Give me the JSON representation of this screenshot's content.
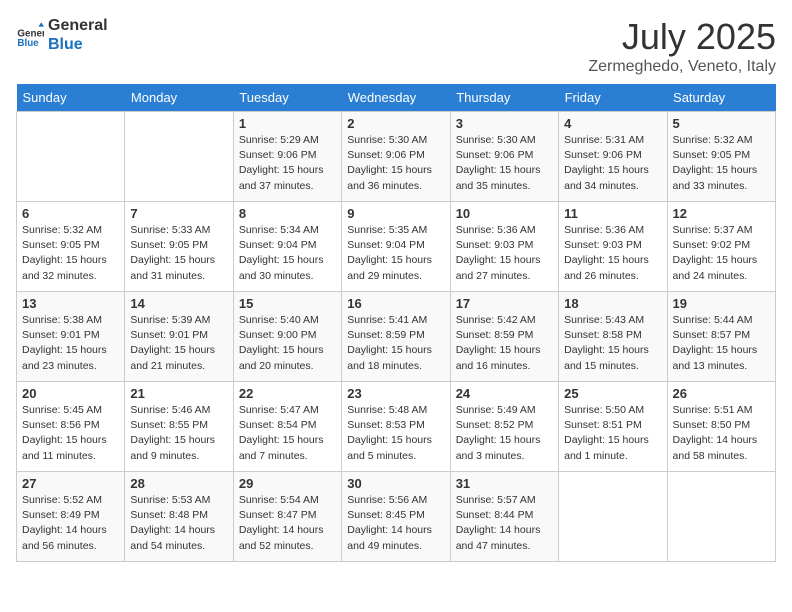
{
  "logo": {
    "line1": "General",
    "line2": "Blue"
  },
  "title": "July 2025",
  "location": "Zermeghedo, Veneto, Italy",
  "weekdays": [
    "Sunday",
    "Monday",
    "Tuesday",
    "Wednesday",
    "Thursday",
    "Friday",
    "Saturday"
  ],
  "weeks": [
    [
      {
        "day": "",
        "info": ""
      },
      {
        "day": "",
        "info": ""
      },
      {
        "day": "1",
        "info": "Sunrise: 5:29 AM\nSunset: 9:06 PM\nDaylight: 15 hours\nand 37 minutes."
      },
      {
        "day": "2",
        "info": "Sunrise: 5:30 AM\nSunset: 9:06 PM\nDaylight: 15 hours\nand 36 minutes."
      },
      {
        "day": "3",
        "info": "Sunrise: 5:30 AM\nSunset: 9:06 PM\nDaylight: 15 hours\nand 35 minutes."
      },
      {
        "day": "4",
        "info": "Sunrise: 5:31 AM\nSunset: 9:06 PM\nDaylight: 15 hours\nand 34 minutes."
      },
      {
        "day": "5",
        "info": "Sunrise: 5:32 AM\nSunset: 9:05 PM\nDaylight: 15 hours\nand 33 minutes."
      }
    ],
    [
      {
        "day": "6",
        "info": "Sunrise: 5:32 AM\nSunset: 9:05 PM\nDaylight: 15 hours\nand 32 minutes."
      },
      {
        "day": "7",
        "info": "Sunrise: 5:33 AM\nSunset: 9:05 PM\nDaylight: 15 hours\nand 31 minutes."
      },
      {
        "day": "8",
        "info": "Sunrise: 5:34 AM\nSunset: 9:04 PM\nDaylight: 15 hours\nand 30 minutes."
      },
      {
        "day": "9",
        "info": "Sunrise: 5:35 AM\nSunset: 9:04 PM\nDaylight: 15 hours\nand 29 minutes."
      },
      {
        "day": "10",
        "info": "Sunrise: 5:36 AM\nSunset: 9:03 PM\nDaylight: 15 hours\nand 27 minutes."
      },
      {
        "day": "11",
        "info": "Sunrise: 5:36 AM\nSunset: 9:03 PM\nDaylight: 15 hours\nand 26 minutes."
      },
      {
        "day": "12",
        "info": "Sunrise: 5:37 AM\nSunset: 9:02 PM\nDaylight: 15 hours\nand 24 minutes."
      }
    ],
    [
      {
        "day": "13",
        "info": "Sunrise: 5:38 AM\nSunset: 9:01 PM\nDaylight: 15 hours\nand 23 minutes."
      },
      {
        "day": "14",
        "info": "Sunrise: 5:39 AM\nSunset: 9:01 PM\nDaylight: 15 hours\nand 21 minutes."
      },
      {
        "day": "15",
        "info": "Sunrise: 5:40 AM\nSunset: 9:00 PM\nDaylight: 15 hours\nand 20 minutes."
      },
      {
        "day": "16",
        "info": "Sunrise: 5:41 AM\nSunset: 8:59 PM\nDaylight: 15 hours\nand 18 minutes."
      },
      {
        "day": "17",
        "info": "Sunrise: 5:42 AM\nSunset: 8:59 PM\nDaylight: 15 hours\nand 16 minutes."
      },
      {
        "day": "18",
        "info": "Sunrise: 5:43 AM\nSunset: 8:58 PM\nDaylight: 15 hours\nand 15 minutes."
      },
      {
        "day": "19",
        "info": "Sunrise: 5:44 AM\nSunset: 8:57 PM\nDaylight: 15 hours\nand 13 minutes."
      }
    ],
    [
      {
        "day": "20",
        "info": "Sunrise: 5:45 AM\nSunset: 8:56 PM\nDaylight: 15 hours\nand 11 minutes."
      },
      {
        "day": "21",
        "info": "Sunrise: 5:46 AM\nSunset: 8:55 PM\nDaylight: 15 hours\nand 9 minutes."
      },
      {
        "day": "22",
        "info": "Sunrise: 5:47 AM\nSunset: 8:54 PM\nDaylight: 15 hours\nand 7 minutes."
      },
      {
        "day": "23",
        "info": "Sunrise: 5:48 AM\nSunset: 8:53 PM\nDaylight: 15 hours\nand 5 minutes."
      },
      {
        "day": "24",
        "info": "Sunrise: 5:49 AM\nSunset: 8:52 PM\nDaylight: 15 hours\nand 3 minutes."
      },
      {
        "day": "25",
        "info": "Sunrise: 5:50 AM\nSunset: 8:51 PM\nDaylight: 15 hours\nand 1 minute."
      },
      {
        "day": "26",
        "info": "Sunrise: 5:51 AM\nSunset: 8:50 PM\nDaylight: 14 hours\nand 58 minutes."
      }
    ],
    [
      {
        "day": "27",
        "info": "Sunrise: 5:52 AM\nSunset: 8:49 PM\nDaylight: 14 hours\nand 56 minutes."
      },
      {
        "day": "28",
        "info": "Sunrise: 5:53 AM\nSunset: 8:48 PM\nDaylight: 14 hours\nand 54 minutes."
      },
      {
        "day": "29",
        "info": "Sunrise: 5:54 AM\nSunset: 8:47 PM\nDaylight: 14 hours\nand 52 minutes."
      },
      {
        "day": "30",
        "info": "Sunrise: 5:56 AM\nSunset: 8:45 PM\nDaylight: 14 hours\nand 49 minutes."
      },
      {
        "day": "31",
        "info": "Sunrise: 5:57 AM\nSunset: 8:44 PM\nDaylight: 14 hours\nand 47 minutes."
      },
      {
        "day": "",
        "info": ""
      },
      {
        "day": "",
        "info": ""
      }
    ]
  ]
}
